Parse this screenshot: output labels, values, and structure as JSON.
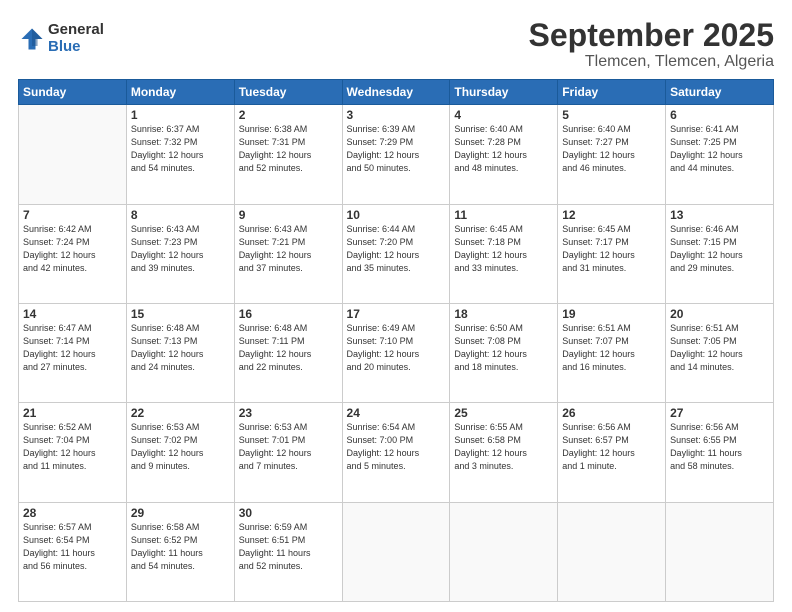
{
  "logo": {
    "general": "General",
    "blue": "Blue"
  },
  "title": "September 2025",
  "location": "Tlemcen, Tlemcen, Algeria",
  "days_of_week": [
    "Sunday",
    "Monday",
    "Tuesday",
    "Wednesday",
    "Thursday",
    "Friday",
    "Saturday"
  ],
  "weeks": [
    [
      {
        "day": "",
        "info": ""
      },
      {
        "day": "1",
        "info": "Sunrise: 6:37 AM\nSunset: 7:32 PM\nDaylight: 12 hours\nand 54 minutes."
      },
      {
        "day": "2",
        "info": "Sunrise: 6:38 AM\nSunset: 7:31 PM\nDaylight: 12 hours\nand 52 minutes."
      },
      {
        "day": "3",
        "info": "Sunrise: 6:39 AM\nSunset: 7:29 PM\nDaylight: 12 hours\nand 50 minutes."
      },
      {
        "day": "4",
        "info": "Sunrise: 6:40 AM\nSunset: 7:28 PM\nDaylight: 12 hours\nand 48 minutes."
      },
      {
        "day": "5",
        "info": "Sunrise: 6:40 AM\nSunset: 7:27 PM\nDaylight: 12 hours\nand 46 minutes."
      },
      {
        "day": "6",
        "info": "Sunrise: 6:41 AM\nSunset: 7:25 PM\nDaylight: 12 hours\nand 44 minutes."
      }
    ],
    [
      {
        "day": "7",
        "info": "Sunrise: 6:42 AM\nSunset: 7:24 PM\nDaylight: 12 hours\nand 42 minutes."
      },
      {
        "day": "8",
        "info": "Sunrise: 6:43 AM\nSunset: 7:23 PM\nDaylight: 12 hours\nand 39 minutes."
      },
      {
        "day": "9",
        "info": "Sunrise: 6:43 AM\nSunset: 7:21 PM\nDaylight: 12 hours\nand 37 minutes."
      },
      {
        "day": "10",
        "info": "Sunrise: 6:44 AM\nSunset: 7:20 PM\nDaylight: 12 hours\nand 35 minutes."
      },
      {
        "day": "11",
        "info": "Sunrise: 6:45 AM\nSunset: 7:18 PM\nDaylight: 12 hours\nand 33 minutes."
      },
      {
        "day": "12",
        "info": "Sunrise: 6:45 AM\nSunset: 7:17 PM\nDaylight: 12 hours\nand 31 minutes."
      },
      {
        "day": "13",
        "info": "Sunrise: 6:46 AM\nSunset: 7:15 PM\nDaylight: 12 hours\nand 29 minutes."
      }
    ],
    [
      {
        "day": "14",
        "info": "Sunrise: 6:47 AM\nSunset: 7:14 PM\nDaylight: 12 hours\nand 27 minutes."
      },
      {
        "day": "15",
        "info": "Sunrise: 6:48 AM\nSunset: 7:13 PM\nDaylight: 12 hours\nand 24 minutes."
      },
      {
        "day": "16",
        "info": "Sunrise: 6:48 AM\nSunset: 7:11 PM\nDaylight: 12 hours\nand 22 minutes."
      },
      {
        "day": "17",
        "info": "Sunrise: 6:49 AM\nSunset: 7:10 PM\nDaylight: 12 hours\nand 20 minutes."
      },
      {
        "day": "18",
        "info": "Sunrise: 6:50 AM\nSunset: 7:08 PM\nDaylight: 12 hours\nand 18 minutes."
      },
      {
        "day": "19",
        "info": "Sunrise: 6:51 AM\nSunset: 7:07 PM\nDaylight: 12 hours\nand 16 minutes."
      },
      {
        "day": "20",
        "info": "Sunrise: 6:51 AM\nSunset: 7:05 PM\nDaylight: 12 hours\nand 14 minutes."
      }
    ],
    [
      {
        "day": "21",
        "info": "Sunrise: 6:52 AM\nSunset: 7:04 PM\nDaylight: 12 hours\nand 11 minutes."
      },
      {
        "day": "22",
        "info": "Sunrise: 6:53 AM\nSunset: 7:02 PM\nDaylight: 12 hours\nand 9 minutes."
      },
      {
        "day": "23",
        "info": "Sunrise: 6:53 AM\nSunset: 7:01 PM\nDaylight: 12 hours\nand 7 minutes."
      },
      {
        "day": "24",
        "info": "Sunrise: 6:54 AM\nSunset: 7:00 PM\nDaylight: 12 hours\nand 5 minutes."
      },
      {
        "day": "25",
        "info": "Sunrise: 6:55 AM\nSunset: 6:58 PM\nDaylight: 12 hours\nand 3 minutes."
      },
      {
        "day": "26",
        "info": "Sunrise: 6:56 AM\nSunset: 6:57 PM\nDaylight: 12 hours\nand 1 minute."
      },
      {
        "day": "27",
        "info": "Sunrise: 6:56 AM\nSunset: 6:55 PM\nDaylight: 11 hours\nand 58 minutes."
      }
    ],
    [
      {
        "day": "28",
        "info": "Sunrise: 6:57 AM\nSunset: 6:54 PM\nDaylight: 11 hours\nand 56 minutes."
      },
      {
        "day": "29",
        "info": "Sunrise: 6:58 AM\nSunset: 6:52 PM\nDaylight: 11 hours\nand 54 minutes."
      },
      {
        "day": "30",
        "info": "Sunrise: 6:59 AM\nSunset: 6:51 PM\nDaylight: 11 hours\nand 52 minutes."
      },
      {
        "day": "",
        "info": ""
      },
      {
        "day": "",
        "info": ""
      },
      {
        "day": "",
        "info": ""
      },
      {
        "day": "",
        "info": ""
      }
    ]
  ]
}
